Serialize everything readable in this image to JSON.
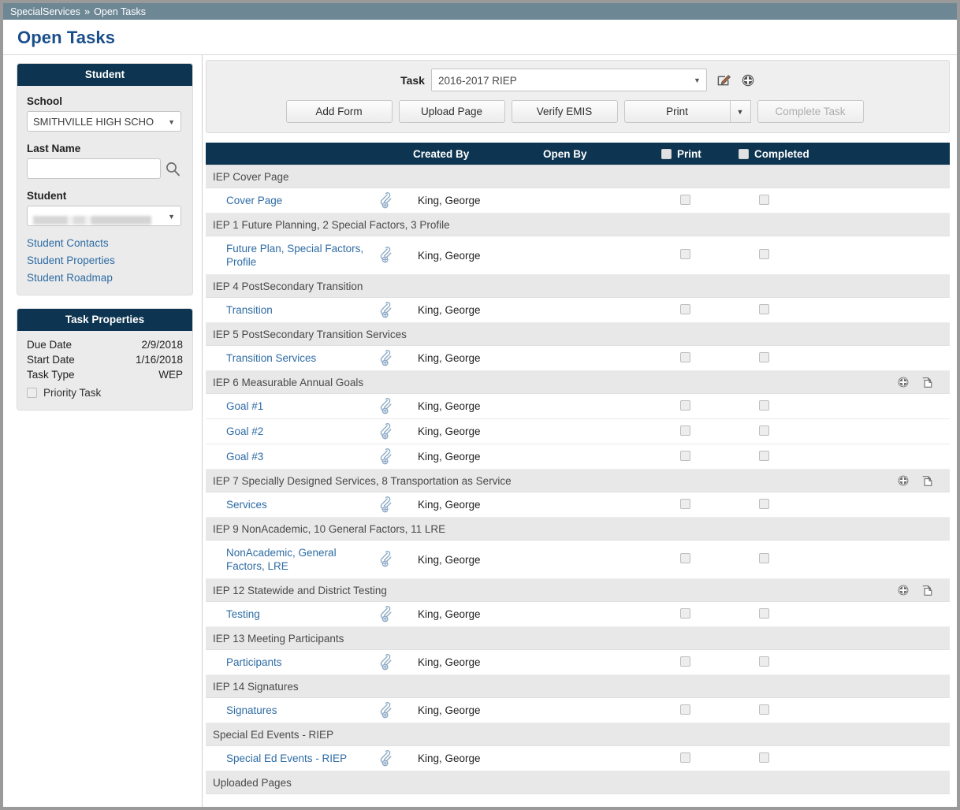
{
  "breadcrumb": {
    "root": "SpecialServices",
    "separator": "»",
    "current": "Open Tasks"
  },
  "page_title": "Open Tasks",
  "colors": {
    "header_navy": "#0d3551",
    "breadcrumb_slate": "#6d8795",
    "title_blue": "#1a4e8a",
    "link_blue": "#2e6ca4",
    "group_gray": "#e8e8e8",
    "panel_gray": "#ebebeb",
    "clip_icon_blue": "#8ba8c4"
  },
  "sidebar": {
    "student_panel": {
      "title": "Student",
      "school_label": "School",
      "school_value": "SMITHVILLE HIGH SCHO",
      "last_name_label": "Last Name",
      "last_name_value": "",
      "last_name_placeholder": "",
      "search_icon": "search-icon",
      "student_label": "Student",
      "student_value": "",
      "student_value_redacted": true,
      "links": [
        {
          "label": "Student Contacts"
        },
        {
          "label": "Student Properties"
        },
        {
          "label": "Student Roadmap"
        }
      ]
    },
    "task_properties_panel": {
      "title": "Task Properties",
      "rows": [
        {
          "label": "Due Date",
          "value": "2/9/2018"
        },
        {
          "label": "Start Date",
          "value": "1/16/2018"
        },
        {
          "label": "Task Type",
          "value": "WEP"
        }
      ],
      "priority_task_label": "Priority Task",
      "priority_task_checked": false
    }
  },
  "toolbar": {
    "task_label": "Task",
    "task_value": "2016-2017 RIEP",
    "edit_icon": "edit-pencil-icon",
    "add_icon": "plus-circle-icon",
    "buttons": [
      {
        "label": "Add Form",
        "disabled": false
      },
      {
        "label": "Upload Page",
        "disabled": false
      },
      {
        "label": "Verify EMIS",
        "disabled": false
      }
    ],
    "print_button": {
      "label": "Print",
      "disabled": false,
      "has_caret": true
    },
    "complete_button": {
      "label": "Complete Task",
      "disabled": true
    }
  },
  "table": {
    "headers": {
      "name": "",
      "clip": "",
      "created_by": "Created By",
      "open_by": "Open By",
      "print": "Print",
      "completed": "Completed",
      "print_checked": false,
      "completed_checked": false
    },
    "groups": [
      {
        "title": "IEP Cover Page",
        "has_actions": false,
        "rows": [
          {
            "name": "Cover Page",
            "clip": "paperclip-add-icon",
            "created_by": "King, George",
            "open_by": "",
            "print_checked": false,
            "completed_checked": false
          }
        ]
      },
      {
        "title": "IEP 1 Future Planning, 2 Special Factors, 3 Profile",
        "has_actions": false,
        "rows": [
          {
            "name": "Future Plan, Special Factors, Profile",
            "clip": "paperclip-add-icon",
            "created_by": "King, George",
            "open_by": "",
            "print_checked": false,
            "completed_checked": false,
            "tall": true
          }
        ]
      },
      {
        "title": "IEP 4 PostSecondary Transition",
        "has_actions": false,
        "rows": [
          {
            "name": "Transition",
            "clip": "paperclip-add-icon",
            "created_by": "King, George",
            "open_by": "",
            "print_checked": false,
            "completed_checked": false
          }
        ]
      },
      {
        "title": "IEP 5 PostSecondary Transition Services",
        "has_actions": false,
        "rows": [
          {
            "name": "Transition Services",
            "clip": "paperclip-add-icon",
            "created_by": "King, George",
            "open_by": "",
            "print_checked": false,
            "completed_checked": false
          }
        ]
      },
      {
        "title": "IEP 6 Measurable Annual Goals",
        "has_actions": true,
        "rows": [
          {
            "name": "Goal #1",
            "clip": "paperclip-add-icon",
            "created_by": "King, George",
            "open_by": "",
            "print_checked": false,
            "completed_checked": false
          },
          {
            "name": "Goal #2",
            "clip": "paperclip-add-icon",
            "created_by": "King, George",
            "open_by": "",
            "print_checked": false,
            "completed_checked": false
          },
          {
            "name": "Goal #3",
            "clip": "paperclip-add-icon",
            "created_by": "King, George",
            "open_by": "",
            "print_checked": false,
            "completed_checked": false
          }
        ]
      },
      {
        "title": "IEP 7 Specially Designed Services, 8 Transportation as Service",
        "has_actions": true,
        "rows": [
          {
            "name": "Services",
            "clip": "paperclip-add-icon",
            "created_by": "King, George",
            "open_by": "",
            "print_checked": false,
            "completed_checked": false
          }
        ]
      },
      {
        "title": "IEP 9 NonAcademic, 10 General Factors, 11 LRE",
        "has_actions": false,
        "rows": [
          {
            "name": "NonAcademic, General Factors, LRE",
            "clip": "paperclip-add-icon",
            "created_by": "King, George",
            "open_by": "",
            "print_checked": false,
            "completed_checked": false,
            "tall": true
          }
        ]
      },
      {
        "title": "IEP 12 Statewide and District Testing",
        "has_actions": true,
        "rows": [
          {
            "name": "Testing",
            "clip": "paperclip-add-icon",
            "created_by": "King, George",
            "open_by": "",
            "print_checked": false,
            "completed_checked": false
          }
        ]
      },
      {
        "title": "IEP 13 Meeting Participants",
        "has_actions": false,
        "rows": [
          {
            "name": "Participants",
            "clip": "paperclip-add-icon",
            "created_by": "King, George",
            "open_by": "",
            "print_checked": false,
            "completed_checked": false
          }
        ]
      },
      {
        "title": "IEP 14 Signatures",
        "has_actions": false,
        "rows": [
          {
            "name": "Signatures",
            "clip": "paperclip-add-icon",
            "created_by": "King, George",
            "open_by": "",
            "print_checked": false,
            "completed_checked": false
          }
        ]
      },
      {
        "title": "Special Ed Events - RIEP",
        "has_actions": false,
        "rows": [
          {
            "name": "Special Ed Events - RIEP",
            "clip": "paperclip-add-icon",
            "created_by": "King, George",
            "open_by": "",
            "print_checked": false,
            "completed_checked": false
          }
        ]
      },
      {
        "title": "Uploaded Pages",
        "has_actions": false,
        "rows": []
      }
    ],
    "group_action_icons": {
      "add": "plus-circle-icon",
      "duplicate": "copy-pages-icon"
    }
  }
}
